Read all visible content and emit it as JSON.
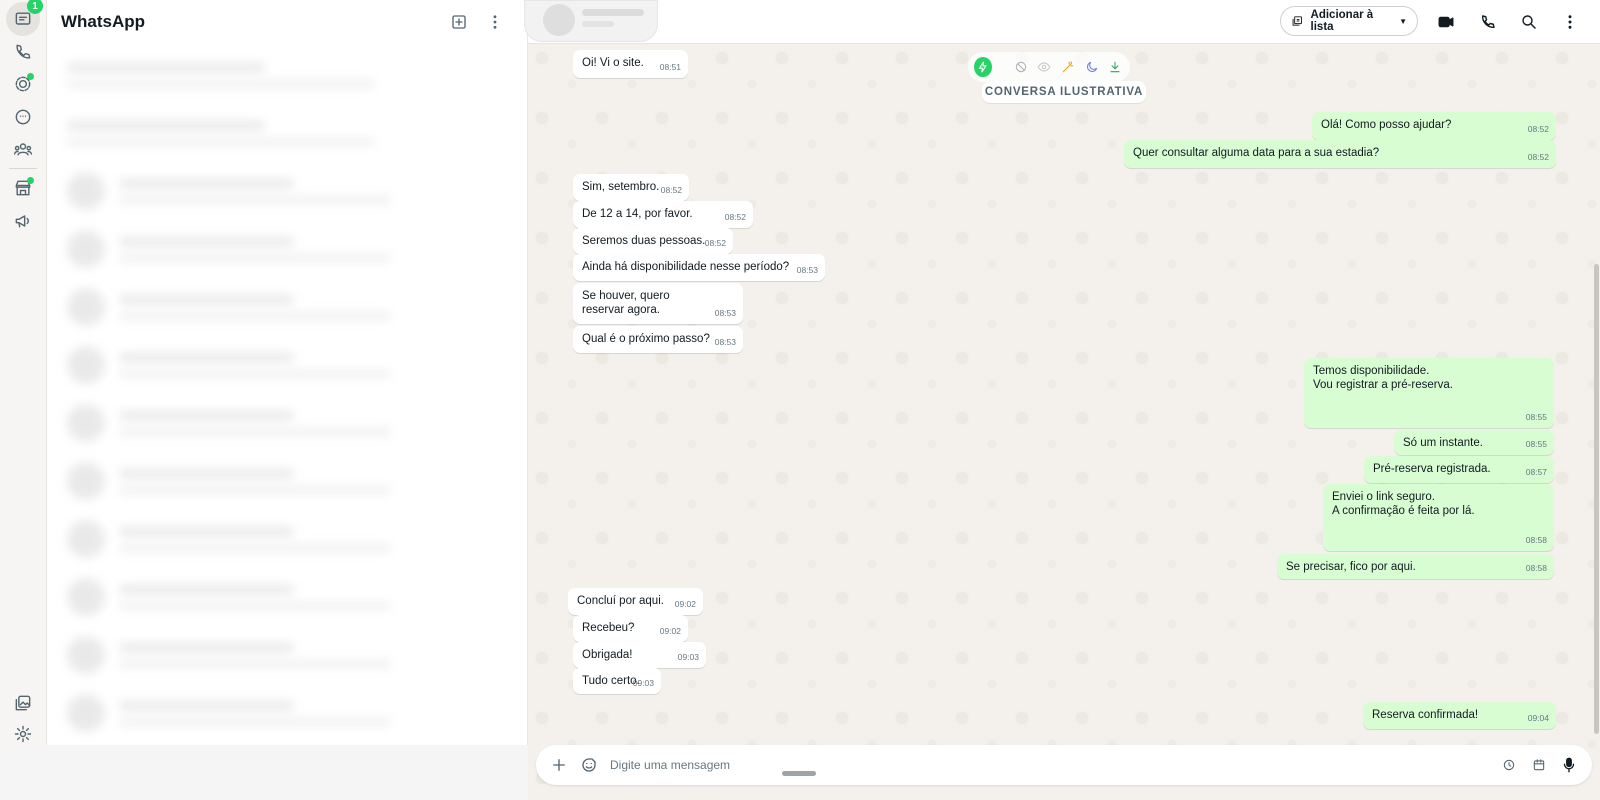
{
  "app": {
    "title": "WhatsApp",
    "unread_count": "1"
  },
  "rail": {
    "items": [
      {
        "name": "chats",
        "icon": "chat-icon"
      },
      {
        "name": "calls",
        "icon": "phone-icon"
      },
      {
        "name": "status",
        "icon": "status-icon"
      },
      {
        "name": "channels",
        "icon": "channels-icon"
      },
      {
        "name": "communities",
        "icon": "communities-icon"
      },
      {
        "name": "tools",
        "icon": "store-icon"
      },
      {
        "name": "ads",
        "icon": "megaphone-icon"
      },
      {
        "name": "media",
        "icon": "gallery-icon"
      },
      {
        "name": "settings",
        "icon": "gear-icon"
      }
    ]
  },
  "chat_header": {
    "add_to_list_label": "Adicionar à lista"
  },
  "notice": "CONVERSA ILUSTRATIVA",
  "messages": [
    {
      "dir": "in",
      "text": "Oi! Vi o site.",
      "time": "08:51"
    },
    {
      "dir": "out",
      "text": "Olá! Como posso ajudar?",
      "time": "08:52"
    },
    {
      "dir": "out",
      "text": "Quer consultar alguma data para a sua estadia?",
      "time": "08:52"
    },
    {
      "dir": "in",
      "text": "Sim, setembro.",
      "time": "08:52"
    },
    {
      "dir": "in",
      "text": "De 12 a 14, por favor.",
      "time": "08:52"
    },
    {
      "dir": "in",
      "text": "Seremos duas pessoas.",
      "time": "08:52"
    },
    {
      "dir": "in",
      "text": "Ainda há disponibilidade nesse período?",
      "time": "08:53"
    },
    {
      "dir": "in",
      "text": "Se houver, quero\nreservar agora.",
      "time": "08:53"
    },
    {
      "dir": "in",
      "text": "Qual é o próximo passo?",
      "time": "08:53"
    },
    {
      "dir": "out",
      "text": "Temos disponibilidade.\nVou registrar a pré-reserva.",
      "time": "08:55"
    },
    {
      "dir": "out",
      "text": "Só um instante.",
      "time": "08:55"
    },
    {
      "dir": "out",
      "text": "Pré-reserva registrada.",
      "time": "08:57"
    },
    {
      "dir": "out",
      "text": "Enviei o link seguro.\nA confirmação é feita por lá.",
      "time": "08:58"
    },
    {
      "dir": "out",
      "text": "Se precisar, fico por aqui.",
      "time": "08:58"
    },
    {
      "dir": "in",
      "text": "Concluí por aqui.",
      "time": "09:02"
    },
    {
      "dir": "in",
      "text": "Recebeu?",
      "time": "09:02"
    },
    {
      "dir": "in",
      "text": "Obrigada!",
      "time": "09:03"
    },
    {
      "dir": "in",
      "text": "Tudo certo.",
      "time": "09:03"
    },
    {
      "dir": "out",
      "text": "Reserva confirmada!",
      "time": "09:04"
    }
  ],
  "composer": {
    "placeholder": "Digite uma mensagem"
  },
  "colors": {
    "accent": "#25d366",
    "outgoing_bubble": "#d9fdd3",
    "incoming_bubble": "#ffffff",
    "chat_background": "#f4f1ec"
  }
}
